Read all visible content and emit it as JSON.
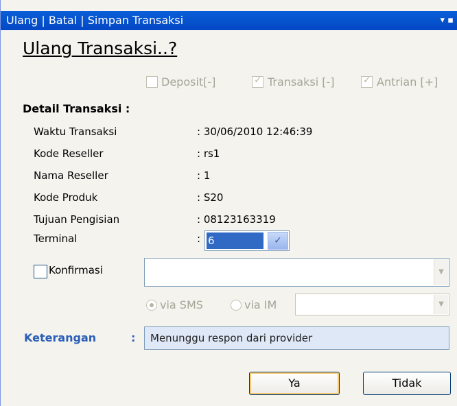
{
  "window": {
    "title": "Ulang | Batal | Simpan Transaksi",
    "pin_glyph": "▾ ▪"
  },
  "heading": "Ulang Transaksi..?",
  "flags": [
    {
      "label": "Deposit[-]",
      "checked": false
    },
    {
      "label": "Transaksi [-]",
      "checked": true
    },
    {
      "label": "Antrian [+]",
      "checked": true
    }
  ],
  "detail": {
    "title": "Detail Transaksi :",
    "rows": [
      {
        "label": "Waktu Transaksi",
        "value": ": 30/06/2010 12:46:39"
      },
      {
        "label": "Kode Reseller",
        "value": ": rs1"
      },
      {
        "label": "Nama Reseller",
        "value": ": 1"
      },
      {
        "label": "Kode Produk",
        "value": ": S20"
      },
      {
        "label": "Tujuan Pengisian",
        "value": ": 08123163319"
      }
    ],
    "terminal": {
      "label": "Terminal",
      "colon": ":",
      "value": "6"
    }
  },
  "konfirmasi": {
    "label": "Konfirmasi",
    "checked": false,
    "value": ""
  },
  "via": [
    {
      "label": "via SMS",
      "selected": true
    },
    {
      "label": "via IM",
      "selected": false
    }
  ],
  "keterangan": {
    "label": "Keterangan",
    "colon": ":",
    "value": "Menunggu respon dari provider"
  },
  "buttons": {
    "yes": "Ya",
    "no": "Tidak"
  },
  "colors": {
    "title_bar": "#0a5fd8",
    "keterangan_label": "#2b5fb8",
    "selection": "#316ac5"
  }
}
